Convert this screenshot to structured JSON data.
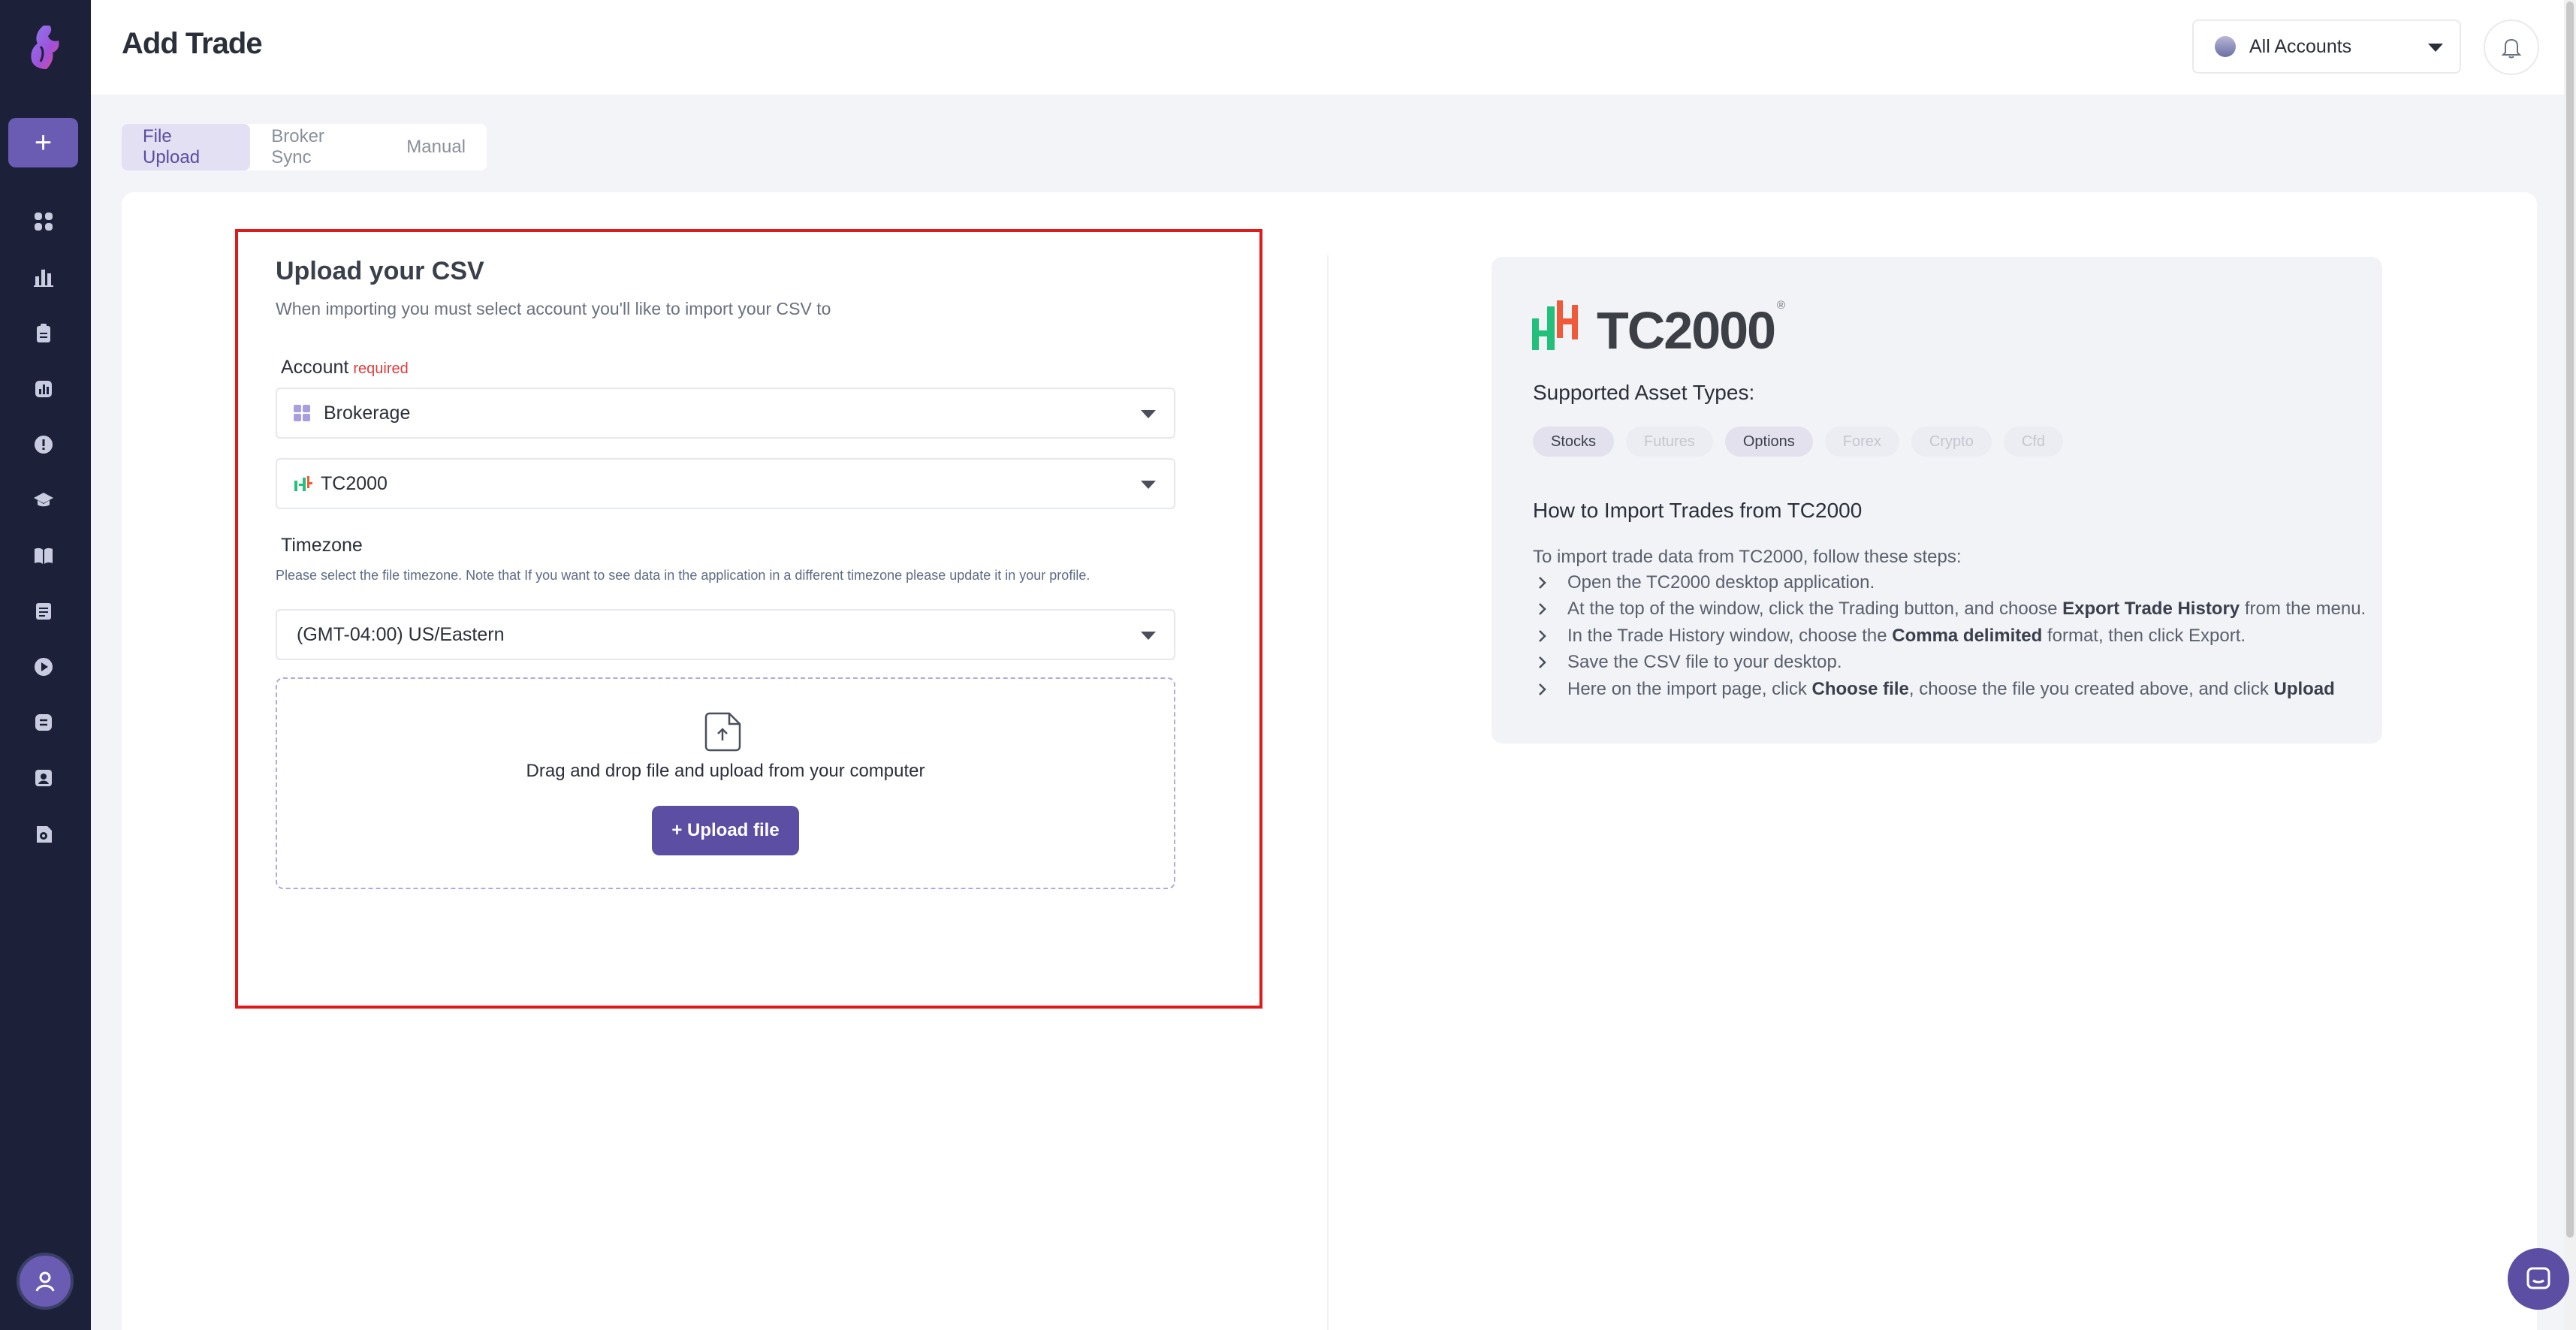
{
  "app": {
    "page_title": "Add Trade"
  },
  "header": {
    "account_selector": "All Accounts"
  },
  "sidebar": {
    "add_label": "+",
    "items": [
      {
        "icon": "dashboard-icon"
      },
      {
        "icon": "reports-icon"
      },
      {
        "icon": "journal-icon"
      },
      {
        "icon": "analytics-icon"
      },
      {
        "icon": "alert-icon"
      },
      {
        "icon": "education-icon"
      },
      {
        "icon": "playbook-icon"
      },
      {
        "icon": "notebook-icon"
      },
      {
        "icon": "replay-icon"
      },
      {
        "icon": "backtest-icon"
      },
      {
        "icon": "profile-card-icon"
      },
      {
        "icon": "resources-icon"
      }
    ]
  },
  "tabs": [
    {
      "label": "File Upload",
      "active": true
    },
    {
      "label": "Broker Sync",
      "active": false
    },
    {
      "label": "Manual",
      "active": false
    }
  ],
  "upload": {
    "title": "Upload your CSV",
    "subtitle": "When importing you must select account you'll like to import your CSV to",
    "account_label": "Account",
    "required_label": "required",
    "account_value": "Brokerage",
    "broker_value": "TC2000",
    "timezone_label": "Timezone",
    "timezone_note": "Please select the file timezone. Note that If you want to see data in the application in a different timezone please update it in your profile.",
    "timezone_value": "(GMT-04:00) US/Eastern",
    "drop_text": "Drag and drop file and upload from your computer",
    "upload_button": "+ Upload file"
  },
  "info": {
    "logo_text": "TC2000",
    "logo_reg": "®",
    "supported_title": "Supported Asset Types:",
    "assets": [
      {
        "label": "Stocks",
        "supported": true
      },
      {
        "label": "Futures",
        "supported": false
      },
      {
        "label": "Options",
        "supported": true
      },
      {
        "label": "Forex",
        "supported": false
      },
      {
        "label": "Crypto",
        "supported": false
      },
      {
        "label": "Cfd",
        "supported": false
      }
    ],
    "howto_title": "How to Import Trades from TC2000",
    "intro": "To import trade data from TC2000, follow these steps:",
    "steps": [
      {
        "pre": "Open the TC2000 desktop application.",
        "bold": "",
        "post": "",
        "bold2": ""
      },
      {
        "pre": "At the top of the window, click the Trading button, and choose ",
        "bold": "Export Trade History",
        "post": " from the menu.",
        "bold2": ""
      },
      {
        "pre": "In the Trade History window, choose the ",
        "bold": "Comma delimited",
        "post": " format, then click Export.",
        "bold2": ""
      },
      {
        "pre": "Save the CSV file to your desktop.",
        "bold": "",
        "post": "",
        "bold2": ""
      },
      {
        "pre": "Here on the import page, click ",
        "bold": "Choose file",
        "post": ", choose the file you created above, and click ",
        "bold2": "Upload"
      }
    ]
  },
  "colors": {
    "accent": "#6a5bb3",
    "sidebar_bg": "#1c2139",
    "highlight_border": "#e01a1a",
    "required": "#e03b3b"
  }
}
